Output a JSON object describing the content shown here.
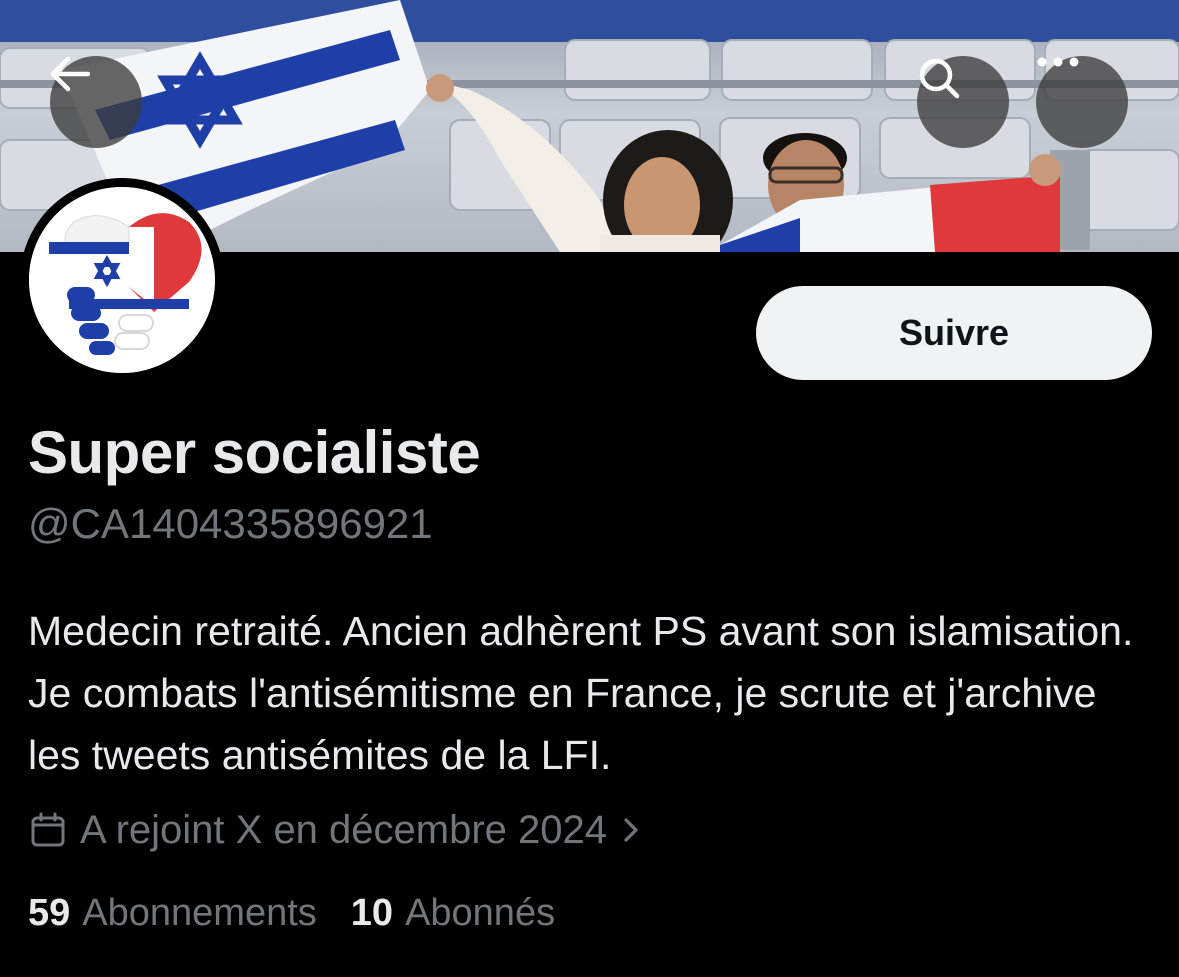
{
  "header": {
    "back_icon": "arrow-left-icon",
    "search_icon": "search-icon",
    "more_icon": "more-horizontal-icon"
  },
  "profile": {
    "display_name": "Super socialiste",
    "handle": "@CA1404335896921",
    "bio": "Medecin retraité. Ancien adhèrent PS avant son islamisation. Je combats l'antisémitisme en France, je scrute et j'archive les tweets antisémites de la LFI.",
    "joined": "A rejoint X en décembre 2024",
    "joined_icon": "calendar-icon"
  },
  "actions": {
    "follow_label": "Suivre"
  },
  "stats": {
    "following_count": "59",
    "following_label": "Abonnements",
    "followers_count": "10",
    "followers_label": "Abonnés"
  },
  "colors": {
    "background": "#000000",
    "primary_text": "#e7e9ea",
    "secondary_text": "#71767b",
    "follow_button_bg": "#eff3f4",
    "follow_button_text": "#0f1419",
    "israel_blue": "#1f3fa8",
    "france_red": "#e0393b"
  }
}
